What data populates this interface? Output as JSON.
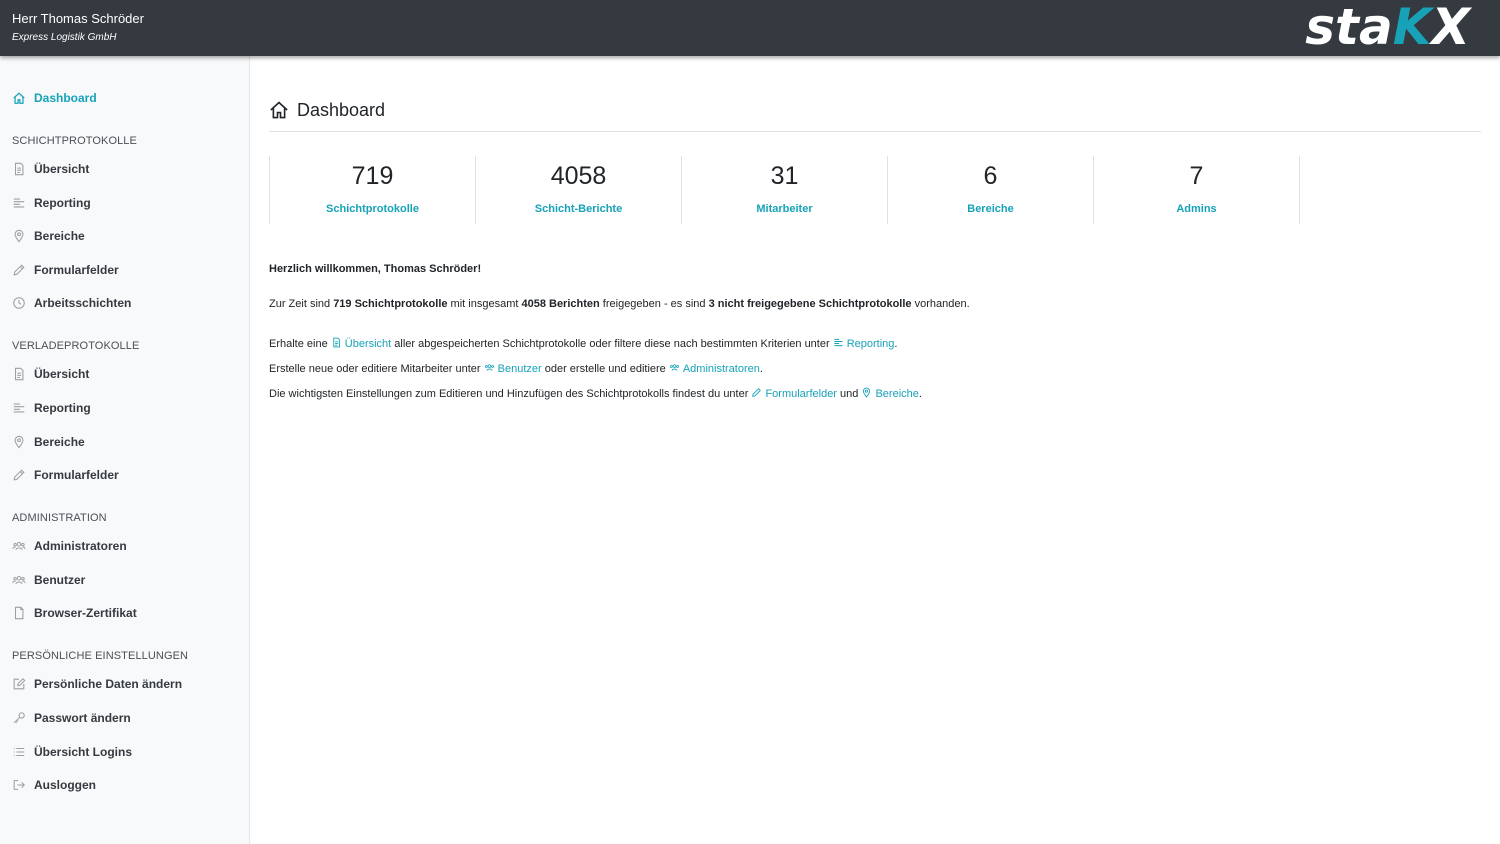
{
  "header": {
    "user_name": "Herr Thomas Schröder",
    "company": "Express Logistik GmbH",
    "logo": {
      "pre": "sta",
      "accent": "K",
      "post": "X"
    }
  },
  "sidebar": {
    "dashboard": "Dashboard",
    "sections": {
      "schicht": "SCHICHTPROTOKOLLE",
      "verlade": "VERLADEPROTOKOLLE",
      "admin": "ADMINISTRATION",
      "personal": "PERSÖNLICHE EINSTELLUNGEN"
    },
    "schicht_items": [
      "Übersicht",
      "Reporting",
      "Bereiche",
      "Formularfelder",
      "Arbeitsschichten"
    ],
    "verlade_items": [
      "Übersicht",
      "Reporting",
      "Bereiche",
      "Formularfelder"
    ],
    "admin_items": [
      "Administratoren",
      "Benutzer",
      "Browser-Zertifikat"
    ],
    "personal_items": [
      "Persönliche Daten ändern",
      "Passwort ändern",
      "Übersicht Logins",
      "Ausloggen"
    ]
  },
  "main": {
    "title": "Dashboard",
    "stats": [
      {
        "value": "719",
        "label": "Schichtprotokolle"
      },
      {
        "value": "4058",
        "label": "Schicht-Berichte"
      },
      {
        "value": "31",
        "label": "Mitarbeiter"
      },
      {
        "value": "6",
        "label": "Bereiche"
      },
      {
        "value": "7",
        "label": "Admins"
      }
    ],
    "welcome": "Herzlich willkommen, Thomas Schröder!",
    "summary": {
      "t1": "Zur Zeit sind ",
      "b1": "719 Schichtprotokolle",
      "t2": " mit insgesamt ",
      "b2": "4058 Berichten",
      "t3": " freigegeben - es sind ",
      "b3": "3 nicht freigegebene Schichtprotokolle",
      "t4": " vorhanden."
    },
    "line1": {
      "t1": "Erhalte eine ",
      "l1": "Übersicht",
      "t2": " aller abgespeicherten Schichtprotokolle oder filtere diese nach bestimmten Kriterien unter ",
      "l2": "Reporting",
      "t3": "."
    },
    "line2": {
      "t1": "Erstelle neue oder editiere Mitarbeiter unter ",
      "l1": "Benutzer",
      "t2": " oder erstelle und editiere ",
      "l2": "Administratoren",
      "t3": "."
    },
    "line3": {
      "t1": "Die wichtigsten Einstellungen zum Editieren und Hinzufügen des Schichtprotokolls findest du unter ",
      "l1": "Formularfelder",
      "t2": " und ",
      "l2": "Bereiche",
      "t3": "."
    }
  },
  "colors": {
    "accent": "#17a2b8",
    "header_bg": "#343a40",
    "sidebar_bg": "#f8f9fa"
  }
}
